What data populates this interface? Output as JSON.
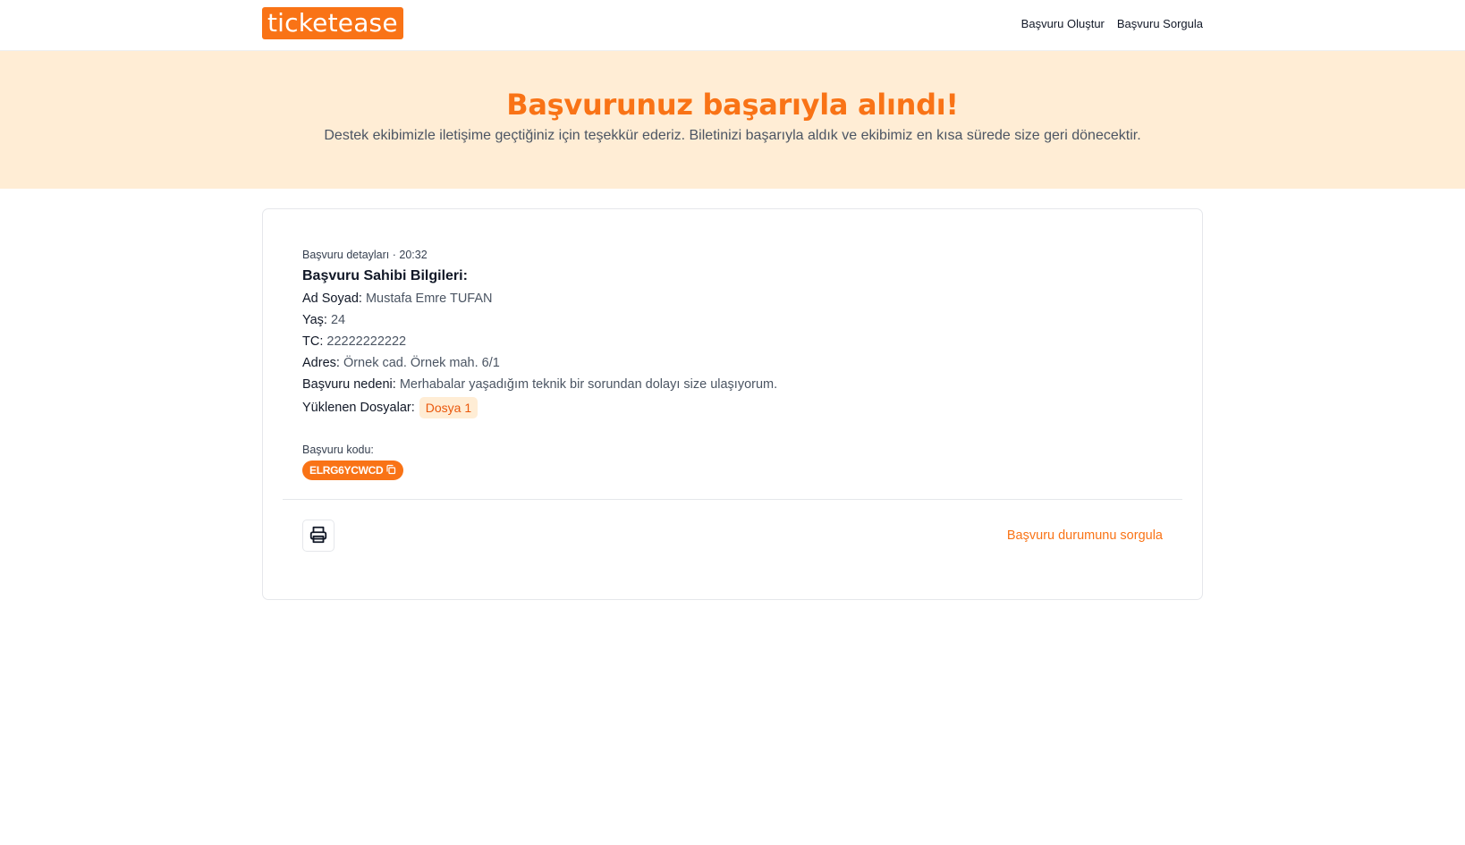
{
  "header": {
    "logo": "ticketease",
    "nav": [
      "Başvuru Oluştur",
      "Başvuru Sorgula"
    ]
  },
  "hero": {
    "title": "Başvurunuz başarıyla alındı!",
    "subtitle": "Destek ekibimizle iletişime geçtiğiniz için teşekkür ederiz. Biletinizi başarıyla aldık ve ekibimiz en kısa sürede size geri dönecektir."
  },
  "details": {
    "meta": "Başvuru detayları · 20:32",
    "section_title": "Başvuru Sahibi Bilgileri:",
    "fields": [
      {
        "label": "Ad Soyad:",
        "value": "Mustafa Emre TUFAN"
      },
      {
        "label": "Yaş:",
        "value": "24"
      },
      {
        "label": "TC:",
        "value": "22222222222"
      },
      {
        "label": "Adres:",
        "value": "Örnek cad. Örnek mah. 6/1"
      },
      {
        "label": "Başvuru nedeni:",
        "value": "Merhabalar yaşadığım teknik bir sorundan dolayı size ulaşıyorum."
      }
    ],
    "files_label": "Yüklenen Dosyalar:",
    "files": [
      "Dosya 1"
    ],
    "code_label": "Başvuru kodu:",
    "code": "ELRG6YCWCD"
  },
  "footer": {
    "print_icon": "printer-icon",
    "status_link": "Başvuru durumunu sorgula"
  },
  "colors": {
    "accent": "#f97316",
    "hero_bg": "#ffedd5",
    "text_muted": "#4b5563"
  }
}
